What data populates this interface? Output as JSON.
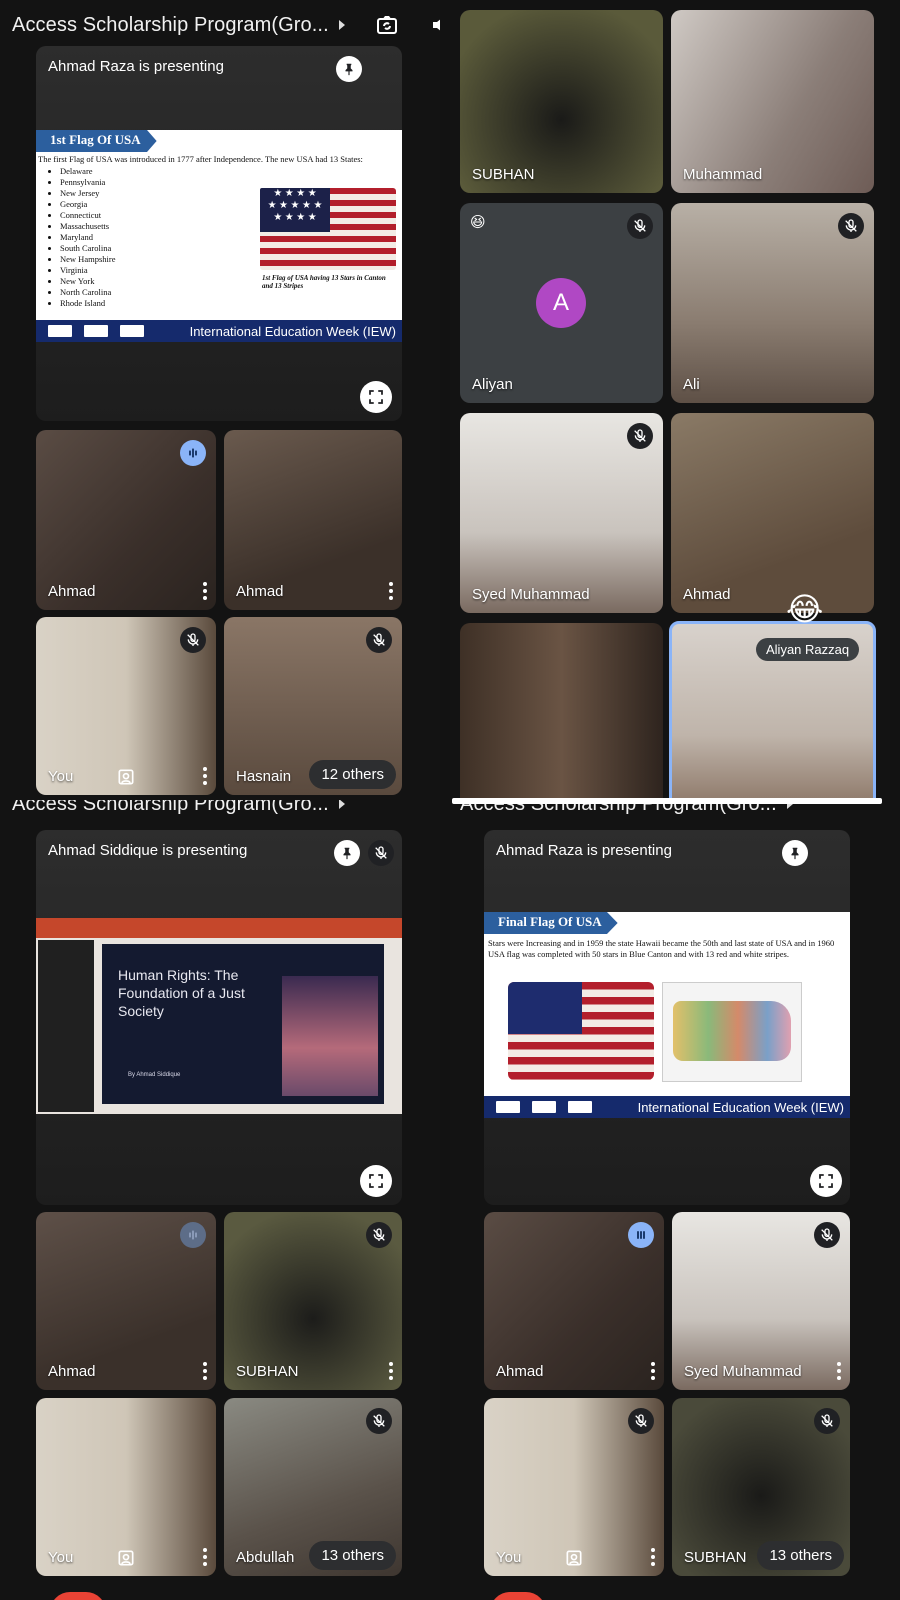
{
  "quadrants": {
    "tl": {
      "title": "Access Scholarship Program(Gro...",
      "presenting": "Ahmad Raza is presenting",
      "slide": {
        "heading": "1st Flag Of USA",
        "intro": "The first Flag of USA was introduced in 1777 after Independence. The new USA had 13 States:",
        "states": [
          "Delaware",
          "Pennsylvania",
          "New Jersey",
          "Georgia",
          "Connecticut",
          "Massachusetts",
          "Maryland",
          "South Carolina",
          "New Hampshire",
          "Virginia",
          "New York",
          "North Carolina",
          "Rhode Island"
        ],
        "caption": "1st Flag of USA having 13 Stars in Canton and 13 Stripes",
        "footer": "International Education Week (IEW)"
      },
      "tiles": [
        {
          "name": "Ahmad"
        },
        {
          "name": "Ahmad"
        },
        {
          "name": "You"
        },
        {
          "name": "Hasnain"
        }
      ],
      "others": "12 others"
    },
    "tr": {
      "tiles": [
        {
          "name": "SUBHAN"
        },
        {
          "name": "Muhammad"
        },
        {
          "name": "Aliyan",
          "avatar": "A",
          "emoji": "😆"
        },
        {
          "name": "Ali"
        },
        {
          "name": "Syed Muhammad"
        },
        {
          "name": "Ahmad"
        },
        {
          "name": ""
        },
        {
          "name": ""
        }
      ],
      "reaction_emoji": "😂",
      "reaction_name": "Aliyan Razzaq"
    },
    "bl": {
      "title": "Access Scholarship Program(Gro...",
      "presenting": "Ahmad Siddique is presenting",
      "slide": {
        "heading": "Human Rights: The Foundation of a Just Society",
        "author": "By Ahmad Siddique"
      },
      "tiles": [
        {
          "name": "Ahmad"
        },
        {
          "name": "SUBHAN"
        },
        {
          "name": "You"
        },
        {
          "name": "Abdullah"
        }
      ],
      "others": "13 others"
    },
    "br": {
      "title": "Access Scholarship Program(Gro...",
      "presenting": "Ahmad Raza is presenting",
      "slide": {
        "heading": "Final Flag Of USA",
        "text": "Stars were Increasing and in 1959 the state Hawaii became the 50th and last state of USA and in 1960 USA flag was completed with 50 stars in Blue Canton and with 13 red and white stripes.",
        "footer": "International Education Week (IEW)"
      },
      "tiles": [
        {
          "name": "Ahmad"
        },
        {
          "name": "Syed Muhammad"
        },
        {
          "name": "You"
        },
        {
          "name": "SUBHAN"
        }
      ],
      "others": "13 others"
    }
  },
  "colors": {
    "background": "#121212",
    "speaking_blue": "#8ab4f8",
    "avatar_purple": "#b048c4",
    "slide_blue": "#2c5f9e",
    "footer_navy": "#152a6c"
  },
  "icons": [
    "camera-switch-icon",
    "speaker-icon",
    "pin-icon",
    "fullscreen-icon",
    "mic-off-icon",
    "audio-wave-icon",
    "more-vert-icon",
    "add-person-icon"
  ]
}
